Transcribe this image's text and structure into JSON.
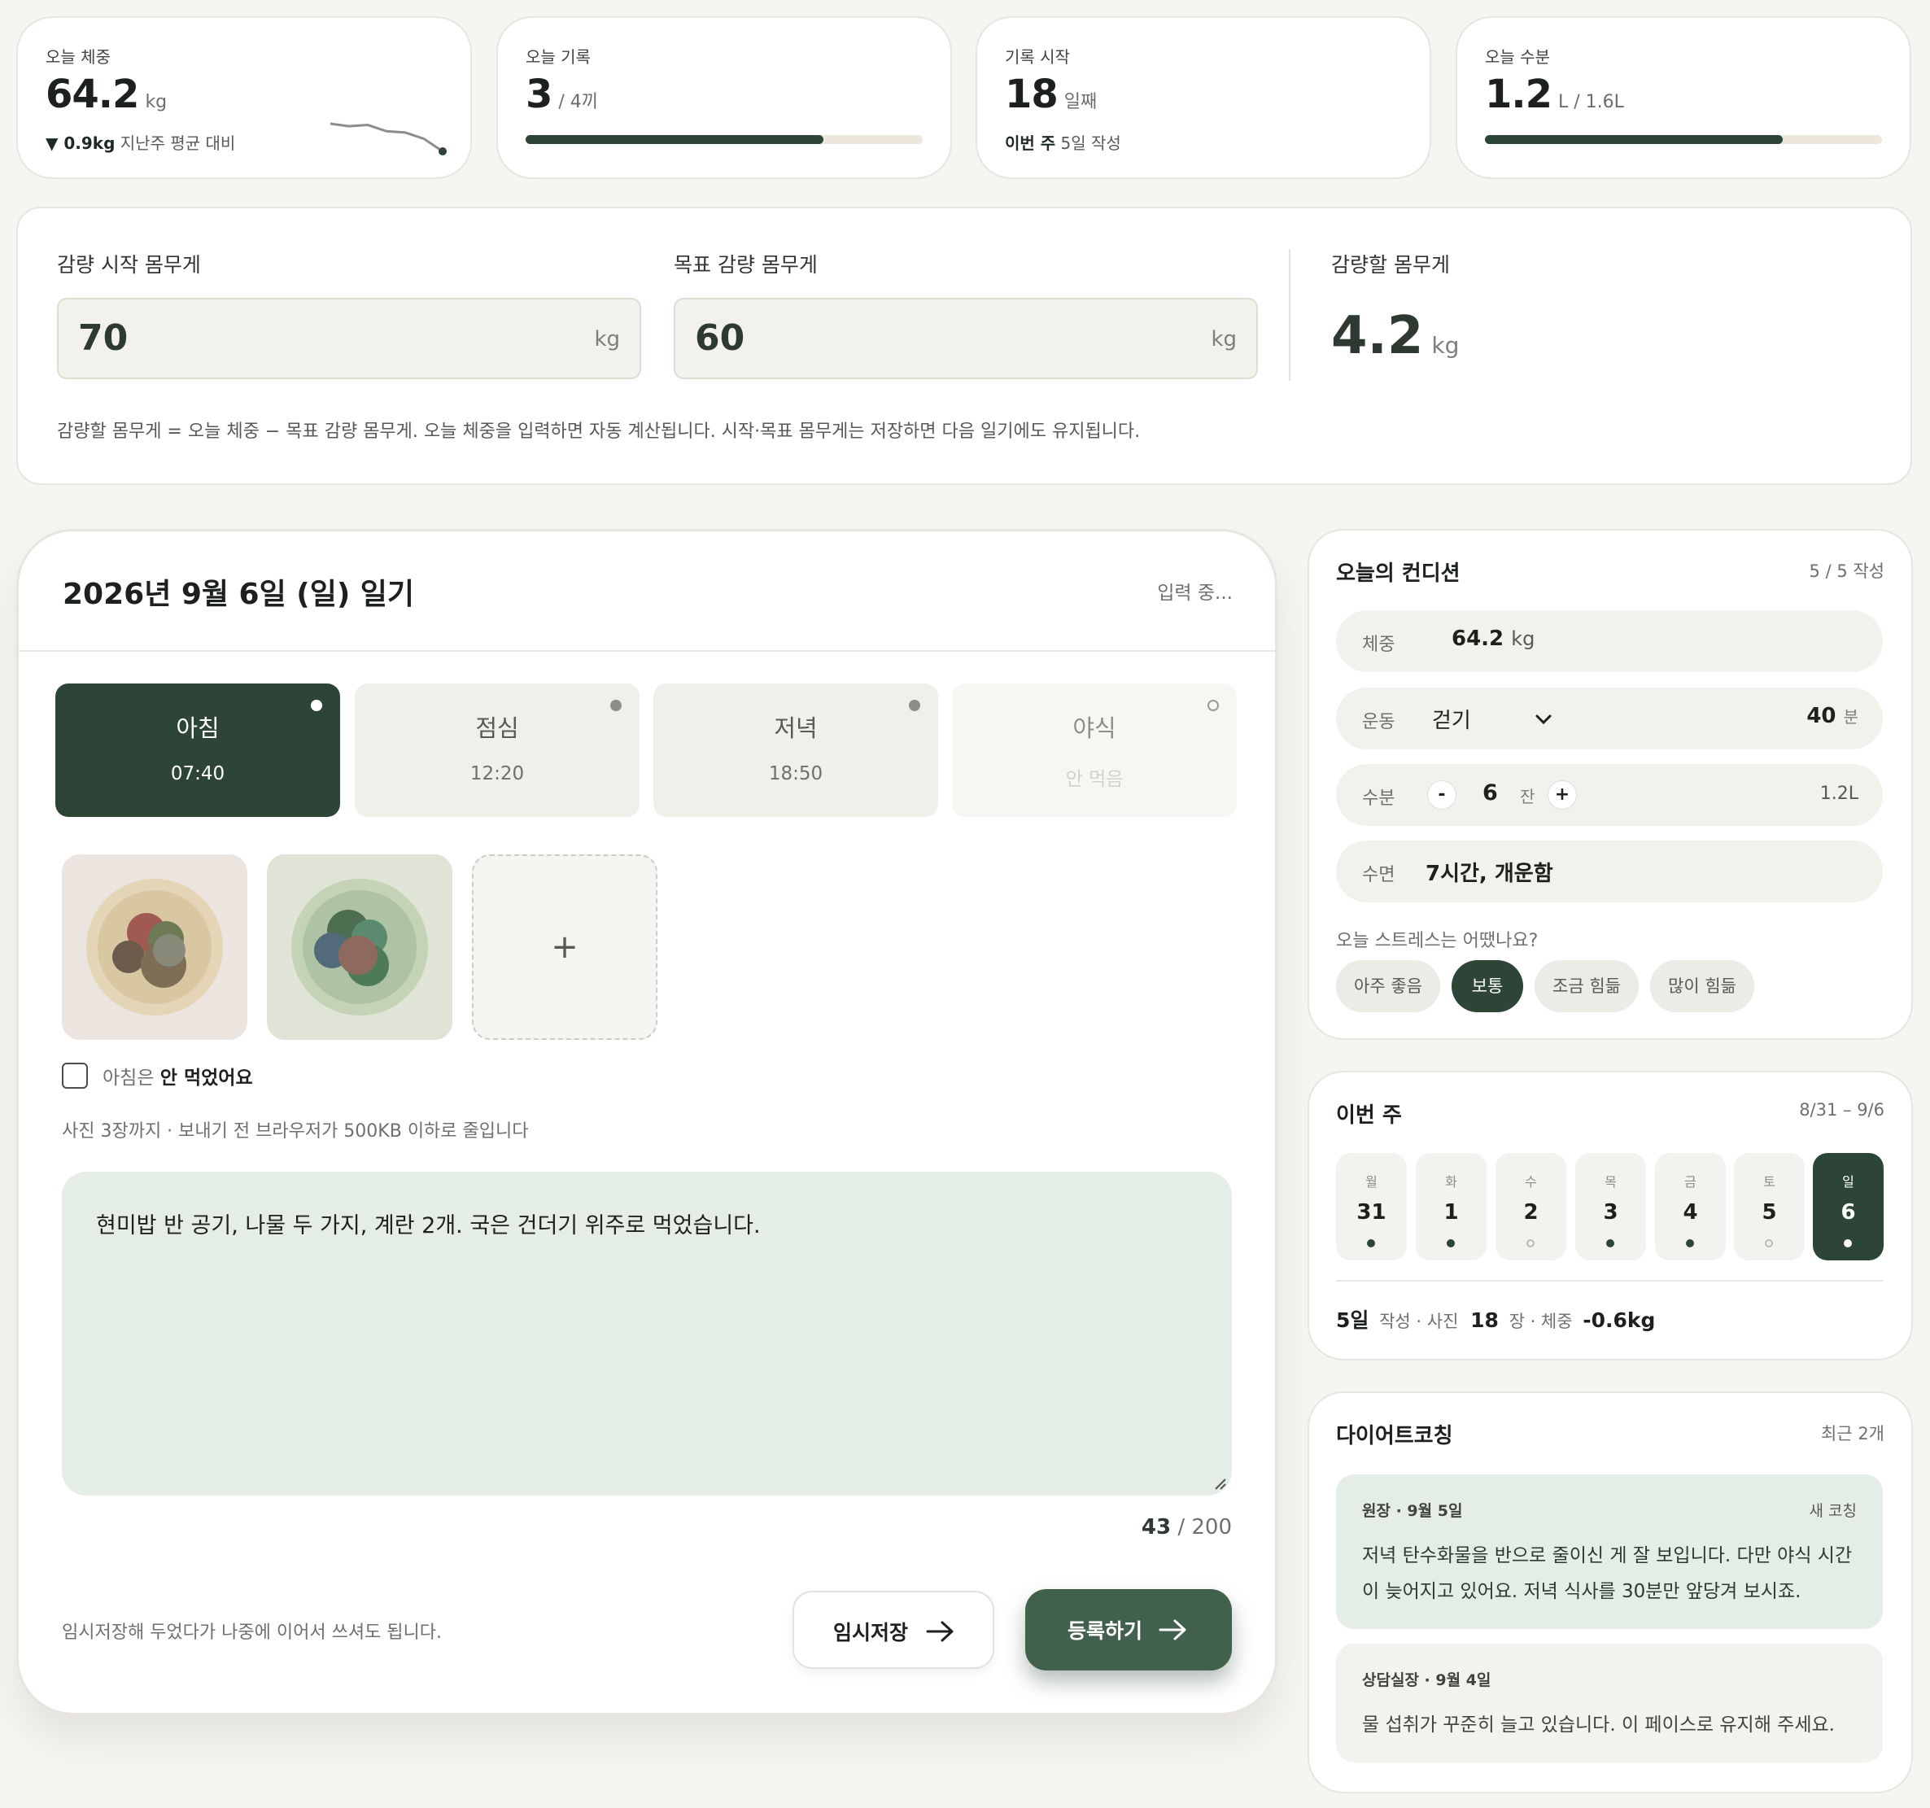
{
  "stats": {
    "weight": {
      "label": "오늘 체중",
      "value": "64.2",
      "unit": "kg",
      "delta": "▼ 0.9kg",
      "delta_note": "지난주 평균 대비",
      "trend": [
        65.3,
        65.2,
        65.25,
        65.0,
        64.95,
        64.7,
        64.2
      ]
    },
    "meals": {
      "label": "오늘 기록",
      "value": "3",
      "unit": "/ 4끼",
      "progress": 0.75
    },
    "since": {
      "label": "기록 시작",
      "value": "18",
      "unit": "일째",
      "foot_bold": "이번 주",
      "foot": "5일 작성"
    },
    "water": {
      "label": "오늘 수분",
      "value": "1.2",
      "unit": "L / 1.6L",
      "progress": 0.75
    }
  },
  "goal": {
    "start_label": "감량 시작 몸무게",
    "start_value": "70",
    "start_unit": "kg",
    "target_label": "목표 감량 몸무게",
    "target_value": "60",
    "target_unit": "kg",
    "remain_label": "감량할 몸무게",
    "remain_value": "4.2",
    "remain_unit": "kg",
    "note": "감량할 몸무게 = 오늘 체중 − 목표 감량 몸무게. 오늘 체중을 입력하면 자동 계산됩니다. 시작·목표 몸무게는 저장하면 다음 일기에도 유지됩니다."
  },
  "diary": {
    "title": "2026년 9월 6일 (일) 일기",
    "status": "입력 중...",
    "meals": [
      {
        "name": "아침",
        "time": "07:40"
      },
      {
        "name": "점심",
        "time": "12:20"
      },
      {
        "name": "저녁",
        "time": "18:50"
      },
      {
        "name": "야식",
        "time": "안 먹음"
      }
    ],
    "add_photo": "+",
    "skip_prefix": "아침은",
    "skip_bold": "안 먹었어요",
    "photo_hint": "사진 3장까지 · 보내기 전 브라우저가 500KB 이하로 줄입니다",
    "text": "현미밥 반 공기, 나물 두 가지, 계란 2개. 국은 건더기 위주로 먹었습니다.",
    "count": "43",
    "count_max": "/ 200",
    "save_hint": "임시저장해 두었다가 나중에 이어서 쓰셔도 됩니다.",
    "draft_label": "임시저장",
    "submit_label": "등록하기"
  },
  "condition": {
    "title": "오늘의 컨디션",
    "count": "5 / 5 작성",
    "weight_label": "체중",
    "weight_value": "64.2",
    "weight_unit": "kg",
    "exercise_label": "운동",
    "exercise_value": "걷기",
    "exercise_minutes": "40",
    "exercise_unit": "분",
    "water_label": "수분",
    "water_minus": "-",
    "water_count": "6",
    "water_unit": "잔",
    "water_plus": "+",
    "water_total": "1.2L",
    "sleep_label": "수면",
    "sleep_value": "7시간, 개운함",
    "stress_question": "오늘 스트레스는 어땠나요?",
    "stress_options": [
      "아주 좋음",
      "보통",
      "조금 힘듦",
      "많이 힘듦"
    ],
    "stress_selected": "보통"
  },
  "week": {
    "title": "이번 주",
    "range": "8/31 – 9/6",
    "days": [
      {
        "w": "월",
        "d": "31",
        "done": true
      },
      {
        "w": "화",
        "d": "1",
        "done": true
      },
      {
        "w": "수",
        "d": "2",
        "done": false
      },
      {
        "w": "목",
        "d": "3",
        "done": true
      },
      {
        "w": "금",
        "d": "4",
        "done": true
      },
      {
        "w": "토",
        "d": "5",
        "done": false
      },
      {
        "w": "일",
        "d": "6",
        "done": true
      }
    ],
    "summary": {
      "days": "5일",
      "days_note": "작성 · 사진",
      "photos": "18",
      "photos_note": "장 · 체중",
      "weight": "-0.6kg"
    }
  },
  "coaching": {
    "title": "다이어트코칭",
    "count": "최근 2개",
    "items": [
      {
        "author": "원장 · 9월 5일",
        "badge": "새 코칭",
        "text": "저녁 탄수화물을 반으로 줄이신 게 잘 보입니다. 다만 야식 시간이 늦어지고 있어요. 저녁 식사를 30분만 앞당겨 보시죠."
      },
      {
        "author": "상담실장 · 9월 4일",
        "badge": "",
        "text": "물 섭취가 꾸준히 늘고 있습니다. 이 페이스로 유지해 주세요."
      }
    ]
  },
  "colors": {
    "accent": "#2c4536",
    "note_bg": "#e5eee6",
    "page_bg": "#f7f5f1"
  }
}
